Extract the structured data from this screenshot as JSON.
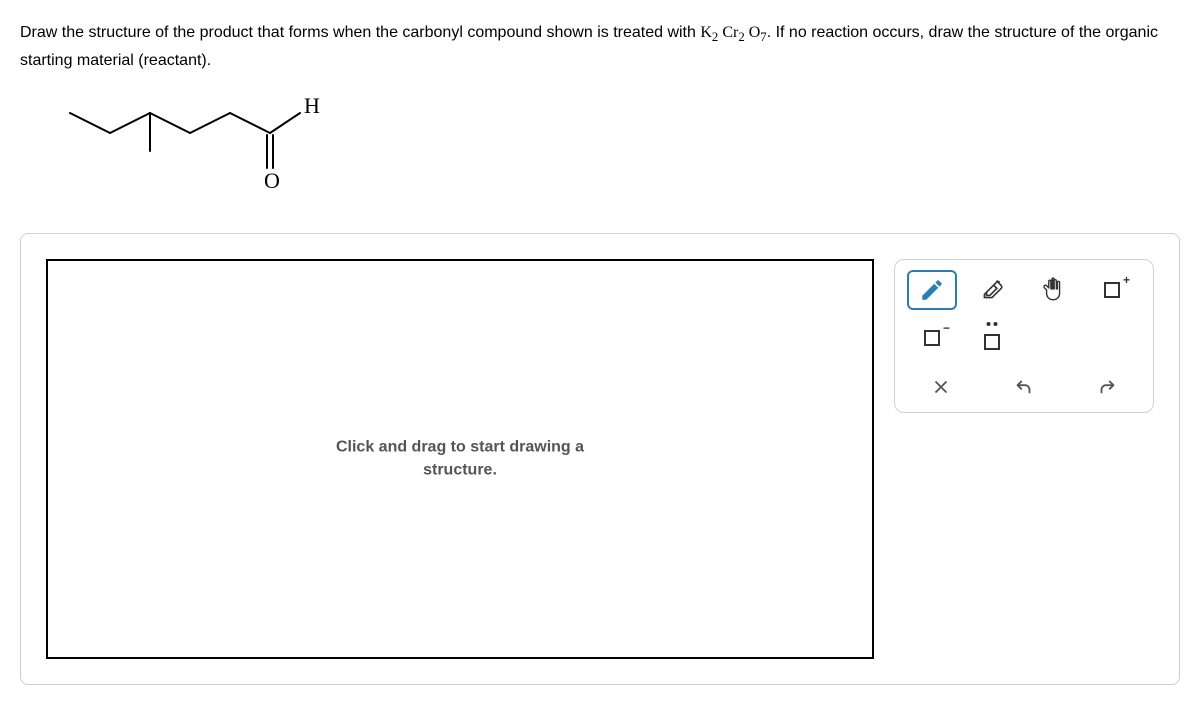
{
  "question": {
    "pre": "Draw the structure of the product that forms when the carbonyl compound shown is treated with ",
    "formula": "K₂ Cr₂ O₇",
    "post": ". If no reaction occurs, draw the structure of the organic starting material (reactant)."
  },
  "molecule": {
    "labels": {
      "H": "H",
      "O": "O"
    }
  },
  "canvas": {
    "placeholder_line1": "Click and drag to start drawing a",
    "placeholder_line2": "structure."
  },
  "tools": {
    "draw": "Draw",
    "erase": "Erase",
    "move": "Move",
    "add_charge": "Add Charge",
    "negative": "Negative Charge",
    "lone_pair": "Lone Pair",
    "clear": "Clear",
    "undo": "Undo",
    "redo": "Redo"
  }
}
